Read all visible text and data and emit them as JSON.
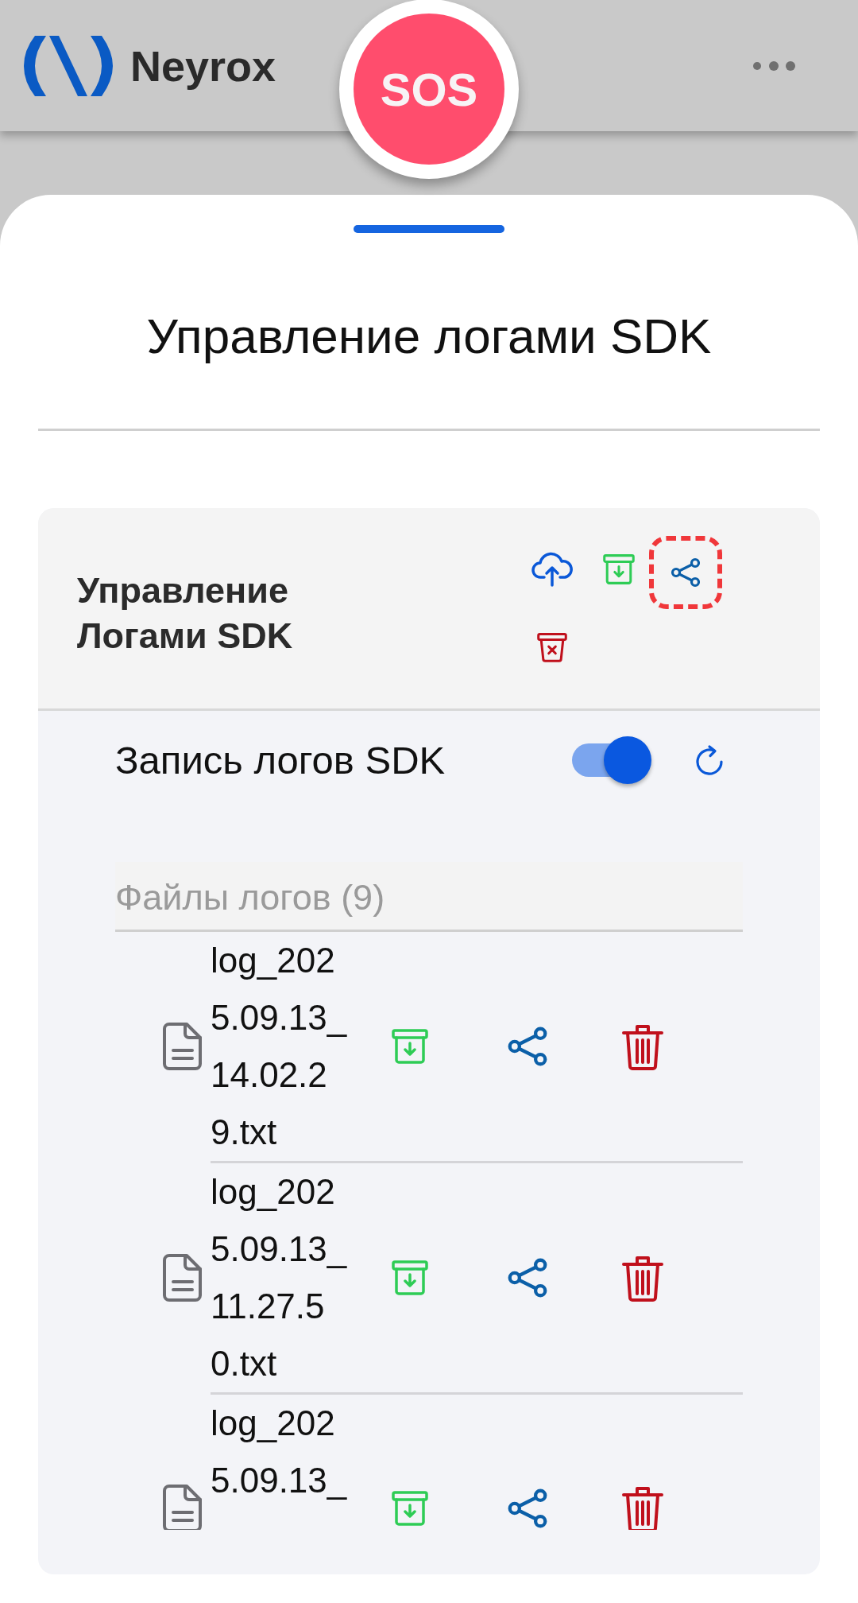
{
  "app_bar": {
    "brand": "Neyrox",
    "sos": "SOS"
  },
  "sheet": {
    "title": "Управление логами SDK",
    "panel": {
      "title": "Управление Логами SDK",
      "actions": [
        {
          "kind": "upload",
          "focused": false
        },
        {
          "kind": "archive",
          "focused": false
        },
        {
          "kind": "share",
          "focused": true
        },
        {
          "kind": "delete",
          "focused": false
        }
      ],
      "recording": {
        "label": "Запись логов SDK",
        "on": true
      },
      "files_header": "Файлы логов (9)",
      "files": [
        {
          "name": "log_2025.09.13_14.02.29.txt"
        },
        {
          "name": "log_2025.09.13_11.27.50.txt"
        },
        {
          "name": "log_2025.09.13_"
        }
      ]
    }
  }
}
